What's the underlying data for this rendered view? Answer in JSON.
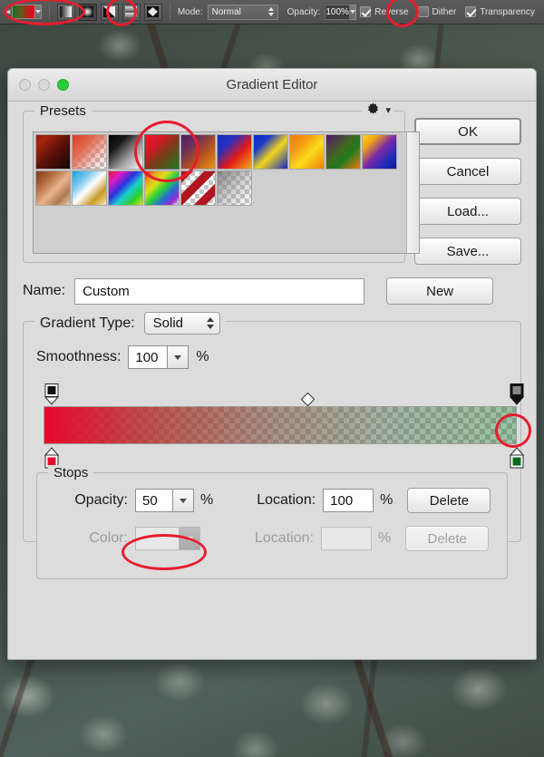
{
  "toolbar": {
    "gradient_swatch_name": "green-to-red-gradient",
    "gradient_types": [
      {
        "name": "linear-gradient-button",
        "selected": false
      },
      {
        "name": "radial-gradient-button",
        "selected": true
      },
      {
        "name": "angle-gradient-button",
        "selected": false
      },
      {
        "name": "reflected-gradient-button",
        "selected": false
      },
      {
        "name": "diamond-gradient-button",
        "selected": false
      }
    ],
    "mode_label": "Mode:",
    "mode_value": "Normal",
    "opacity_label": "Opacity:",
    "opacity_value": "100%",
    "reverse_label": "Reverse",
    "reverse_checked": true,
    "dither_label": "Dither",
    "dither_checked": false,
    "transparency_label": "Transparency",
    "transparency_checked": true
  },
  "dialog": {
    "title": "Gradient Editor",
    "window_controls": [
      "close",
      "minimize",
      "zoom"
    ],
    "presets": {
      "title": "Presets",
      "gear_icon": "gear-icon",
      "selected_index": 3,
      "items": [
        {
          "label": "Foreground to Background",
          "css": "linear-gradient(135deg,#8f1d12 0%,#a8240f 18%,#5e1208 50%,#140604 100%)"
        },
        {
          "label": "Foreground to Transparent",
          "css": "linear-gradient(135deg,#d83f2a 0%,#e06a4f 35%,rgba(224,106,79,.35) 70%,rgba(224,106,79,0) 100%)"
        },
        {
          "label": "Black, White",
          "css": "linear-gradient(135deg,#000 0%,#1a1a1a 28%,#9a9a9a 62%,#ffffff 100%)"
        },
        {
          "label": "Red, Green",
          "css": "linear-gradient(135deg,#e8172a 0%,#d01a22 30%,#7d3a18 55%,#1e7a20 100%)"
        },
        {
          "label": "Violet, Orange",
          "css": "linear-gradient(135deg,#4b2060 0%,#6a2f5c 28%,#b5541d 62%,#f0921c 100%)"
        },
        {
          "label": "Blue, Red, Yellow",
          "css": "linear-gradient(135deg,#1231c2 0%,#2a2fc0 28%,#e01a1a 60%,#f5a81a 100%)"
        },
        {
          "label": "Blue, Yellow, Blue",
          "css": "linear-gradient(135deg,#0f2bc4 0%,#1b38c8 25%,#f4d41c 55%,#0f2bc4 100%)"
        },
        {
          "label": "Orange, Yellow, Orange",
          "css": "linear-gradient(135deg,#f07d0e 0%,#f59a12 30%,#fbdc1c 58%,#f07d0e 100%)"
        },
        {
          "label": "Violet, Green, Orange",
          "css": "linear-gradient(135deg,#5b1570 0%,#3f6a1c 45%,#1c7a20 62%,#f07d0e 100%)"
        },
        {
          "label": "Yellow, Violet, Orange, Blue",
          "css": "linear-gradient(135deg,#f6d41a 0%,#f0a41a 22%,#7a2aa8 50%,#1a2bb8 78%,#0f1a8a 100%)"
        },
        {
          "label": "Copper",
          "css": "linear-gradient(135deg,#7a3a1c 0%,#b06a3c 28%,#e8b48c 55%,#b07a50 78%,#e8cdb4 100%)"
        },
        {
          "label": "Chrome",
          "css": "linear-gradient(135deg,#1d9fe0 0%,#7cc8ee 28%,#ffffff 50%,#c89a2a 75%,#f6e6a8 100%)"
        },
        {
          "label": "Spectrum",
          "css": "linear-gradient(135deg,#e81a2a 0%,#e01ac0 20%,#2a30e0 42%,#1ad0d0 60%,#2ad02a 80%,#d8e01a 100%)"
        },
        {
          "label": "Transparent Rainbow",
          "css": "linear-gradient(135deg,#e81a2a 0%,#e8a41a 18%,#e0e01a 34%,#2ad03a 52%,#2a6ad8 70%,#9a2ad0 86%,rgba(255,255,255,0) 100%)"
        },
        {
          "label": "Transparent Stripes",
          "css": "repeating-linear-gradient(135deg,#b01520 0 9px,rgba(255,255,255,0) 9px 18px)"
        },
        {
          "label": "Neutral Density",
          "css": "linear-gradient(135deg,rgba(120,120,120,.9) 0%,rgba(150,150,150,.4) 55%,rgba(200,200,200,0) 100%)"
        }
      ]
    },
    "buttons": {
      "ok": "OK",
      "cancel": "Cancel",
      "load": "Load...",
      "save": "Save...",
      "new": "New"
    },
    "name_label": "Name:",
    "name_value": "Custom",
    "gradient_type_label": "Gradient Type:",
    "gradient_type_value": "Solid",
    "smoothness_label": "Smoothness:",
    "smoothness_value": "100",
    "smoothness_unit": "%",
    "gradient_bar": {
      "start_color": "#e8082c",
      "end_color": "#0a6b1c",
      "opacity_stops": [
        {
          "name": "opacity-stop-left",
          "location": 0,
          "selected": false
        },
        {
          "name": "opacity-stop-right",
          "location": 100,
          "selected": true
        }
      ],
      "color_stops": [
        {
          "name": "color-stop-left",
          "location": 0,
          "color": "#e8082c"
        },
        {
          "name": "color-stop-right",
          "location": 100,
          "color": "#0a6b1c"
        }
      ],
      "midpoint_marker": "midpoint-diamond"
    },
    "stops": {
      "title": "Stops",
      "opacity_label": "Opacity:",
      "opacity_value": "50",
      "opacity_unit": "%",
      "opacity_location_label": "Location:",
      "opacity_location_value": "100",
      "opacity_location_unit": "%",
      "opacity_delete": "Delete",
      "color_label": "Color:",
      "color_value": "",
      "color_location_label": "Location:",
      "color_location_value": "",
      "color_location_unit": "%",
      "color_delete": "Delete"
    }
  },
  "annotations": [
    {
      "name": "annotation-gradient-swatch"
    },
    {
      "name": "annotation-radial-gradient-button"
    },
    {
      "name": "annotation-reverse-checkbox"
    },
    {
      "name": "annotation-preset-red-green"
    },
    {
      "name": "annotation-opacity-stop-right"
    },
    {
      "name": "annotation-opacity-field"
    }
  ],
  "colors": {
    "annotation": "#e81c2e",
    "dialog_bg": "#dcdcdc",
    "toolbar_bg": "#535353"
  }
}
